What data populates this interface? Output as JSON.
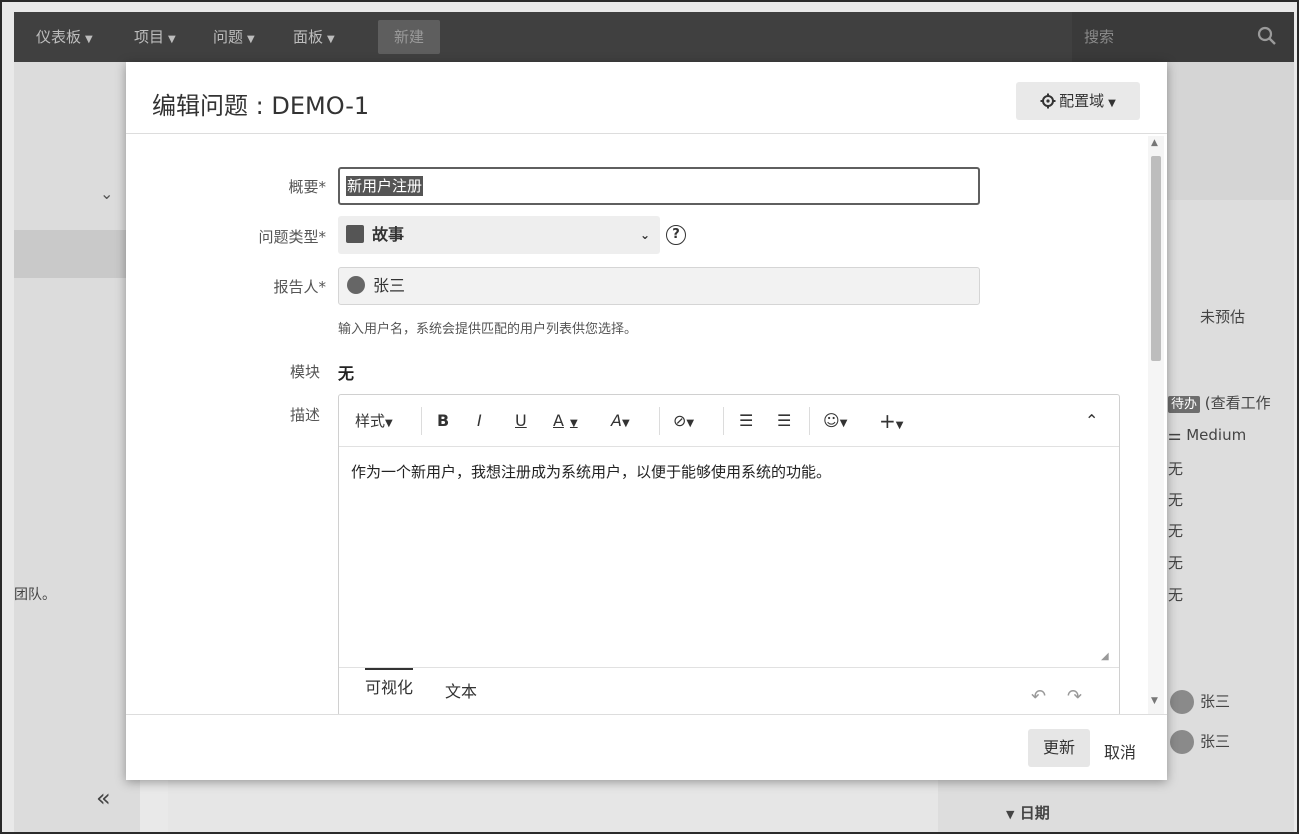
{
  "nav": {
    "items": [
      "仪表板",
      "项目",
      "问题",
      "面板"
    ],
    "new_label": "新建",
    "search_placeholder": "搜索"
  },
  "background": {
    "left_text": "团队。",
    "right_estimate": "未预估",
    "status_badge": "待办",
    "status_link": "(查看工作",
    "priority": "Medium",
    "none_values": [
      "无",
      "无",
      "无",
      "无",
      "无"
    ],
    "people": [
      "张三",
      "张三"
    ],
    "dates_label": "日期",
    "collapse_icon_text": "«"
  },
  "modal": {
    "title": "编辑问题 : DEMO-1",
    "config_label": "配置域",
    "fields": {
      "summary_label": "概要*",
      "summary_value": "新用户注册",
      "type_label": "问题类型*",
      "type_value": "故事",
      "reporter_label": "报告人*",
      "reporter_value": "张三",
      "reporter_hint": "输入用户名，系统会提供匹配的用户列表供您选择。",
      "module_label": "模块",
      "module_value": "无",
      "description_label": "描述",
      "description_text": "作为一个新用户，我想注册成为系统用户，以便于能够使用系统的功能。"
    },
    "toolbar": {
      "style_label": "样式",
      "bold": "B",
      "italic": "I",
      "underline": "U",
      "text_color": "A",
      "font_style": "A",
      "link": "⊘",
      "bullet_list": "☰",
      "numbered_list": "☰",
      "emoji": "☺",
      "insert": "+",
      "collapse": "⌃"
    },
    "editor_tabs": [
      "可视化",
      "文本"
    ],
    "footer": {
      "update_label": "更新",
      "cancel_label": "取消"
    }
  }
}
